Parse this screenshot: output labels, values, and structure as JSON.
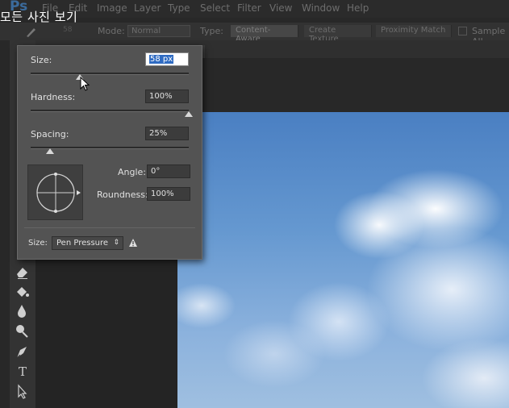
{
  "overlay_caption": "모든 사진 보기",
  "app_logo": "Ps",
  "menu": [
    "File",
    "Edit",
    "Image",
    "Layer",
    "Type",
    "Select",
    "Filter",
    "View",
    "Window",
    "Help"
  ],
  "options_bar": {
    "brush_size_readout": "58",
    "mode_label": "Mode:",
    "mode_value": "Normal",
    "type_label": "Type:",
    "type_options": [
      "Content-Aware",
      "Create Texture",
      "Proximity Match"
    ],
    "type_selected": "Content-Aware",
    "sample_all_label": "Sample All"
  },
  "brush_panel": {
    "size_label": "Size:",
    "size_value": "58 px",
    "size_slider": 0.31,
    "hardness_label": "Hardness:",
    "hardness_value": "100%",
    "hardness_slider": 1.0,
    "spacing_label": "Spacing:",
    "spacing_value": "25%",
    "spacing_slider": 0.12,
    "angle_label": "Angle:",
    "angle_value": "0°",
    "roundness_label": "Roundness:",
    "roundness_value": "100%",
    "size_control_label": "Size:",
    "size_control_value": "Pen Pressure",
    "warning_icon": "warning-icon"
  },
  "tools": [
    "eraser-icon",
    "paint-bucket-icon",
    "blur-icon",
    "dodge-icon",
    "pen-icon",
    "type-icon",
    "path-select-icon"
  ],
  "tool_type_glyph": "T"
}
